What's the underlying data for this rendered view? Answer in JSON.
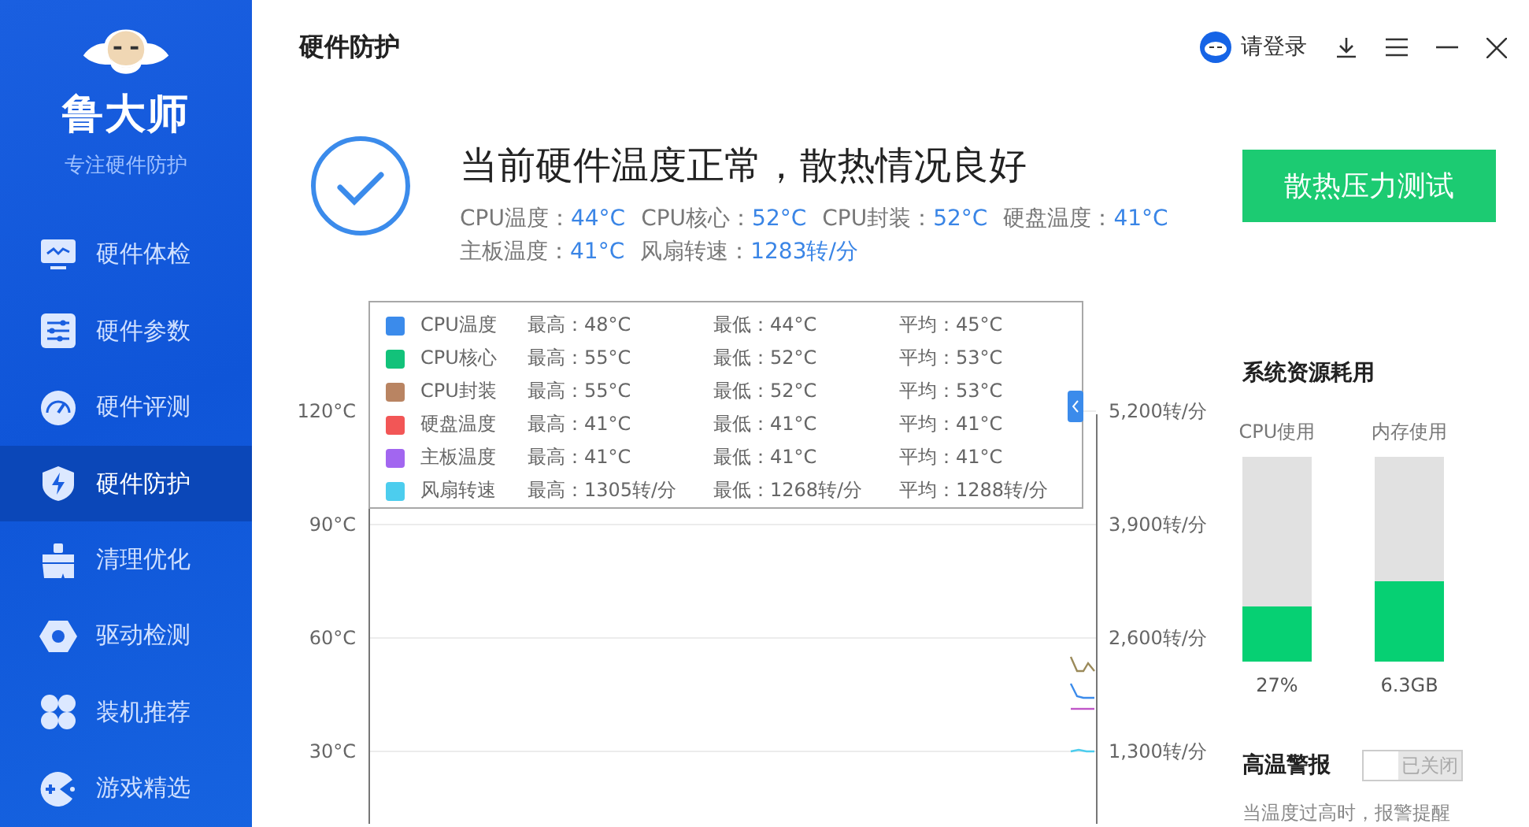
{
  "sidebar": {
    "brand": "鲁大师",
    "slogan": "专注硬件防护",
    "items": [
      {
        "label": "硬件体检",
        "selected": false
      },
      {
        "label": "硬件参数",
        "selected": false
      },
      {
        "label": "硬件评测",
        "selected": false
      },
      {
        "label": "硬件防护",
        "selected": true
      },
      {
        "label": "清理优化",
        "selected": false
      },
      {
        "label": "驱动检测",
        "selected": false
      },
      {
        "label": "装机推荐",
        "selected": false
      },
      {
        "label": "游戏精选",
        "selected": false
      }
    ]
  },
  "header": {
    "title": "硬件防护",
    "login": "请登录"
  },
  "status": {
    "ok": true,
    "headline": "当前硬件温度正常，散热情况良好",
    "readings": [
      [
        {
          "label": "CPU温度：",
          "value": "44°C"
        },
        {
          "label": "CPU核心：",
          "value": "52°C"
        },
        {
          "label": "CPU封装：",
          "value": "52°C"
        },
        {
          "label": "硬盘温度：",
          "value": "41°C"
        }
      ],
      [
        {
          "label": "主板温度：",
          "value": "41°C"
        },
        {
          "label": "风扇转速：",
          "value": "1283转/分"
        }
      ]
    ],
    "button": "散热压力测试"
  },
  "legend": [
    {
      "name": "CPU温度",
      "color": "#3b8beb",
      "max": "最高：48°C",
      "min": "最低：44°C",
      "avg": "平均：45°C"
    },
    {
      "name": "CPU核心",
      "color": "#12c27a",
      "max": "最高：55°C",
      "min": "最低：52°C",
      "avg": "平均：53°C"
    },
    {
      "name": "CPU封装",
      "color": "#b98462",
      "max": "最高：55°C",
      "min": "最低：52°C",
      "avg": "平均：53°C"
    },
    {
      "name": "硬盘温度",
      "color": "#f25656",
      "max": "最高：41°C",
      "min": "最低：41°C",
      "avg": "平均：41°C"
    },
    {
      "name": "主板温度",
      "color": "#a266f0",
      "max": "最高：41°C",
      "min": "最低：41°C",
      "avg": "平均：41°C"
    },
    {
      "name": "风扇转速",
      "color": "#4ccdee",
      "max": "最高：1305转/分",
      "min": "最低：1268转/分",
      "avg": "平均：1288转/分"
    }
  ],
  "chart": {
    "left_ticks": [
      "120°C",
      "90°C",
      "60°C",
      "30°C"
    ],
    "right_ticks": [
      "5,200转/分",
      "3,900转/分",
      "2,600转/分",
      "1,300转/分"
    ]
  },
  "resources": {
    "title": "系统资源耗用",
    "bars": [
      {
        "label": "CPU使用",
        "level": 0.27,
        "reading": "27%"
      },
      {
        "label": "内存使用",
        "level": 0.39,
        "reading": "6.3GB"
      }
    ]
  },
  "alarm": {
    "title": "高温警报",
    "on": false,
    "toggle_label": "已关闭",
    "hint": "当温度过高时，报警提醒"
  }
}
